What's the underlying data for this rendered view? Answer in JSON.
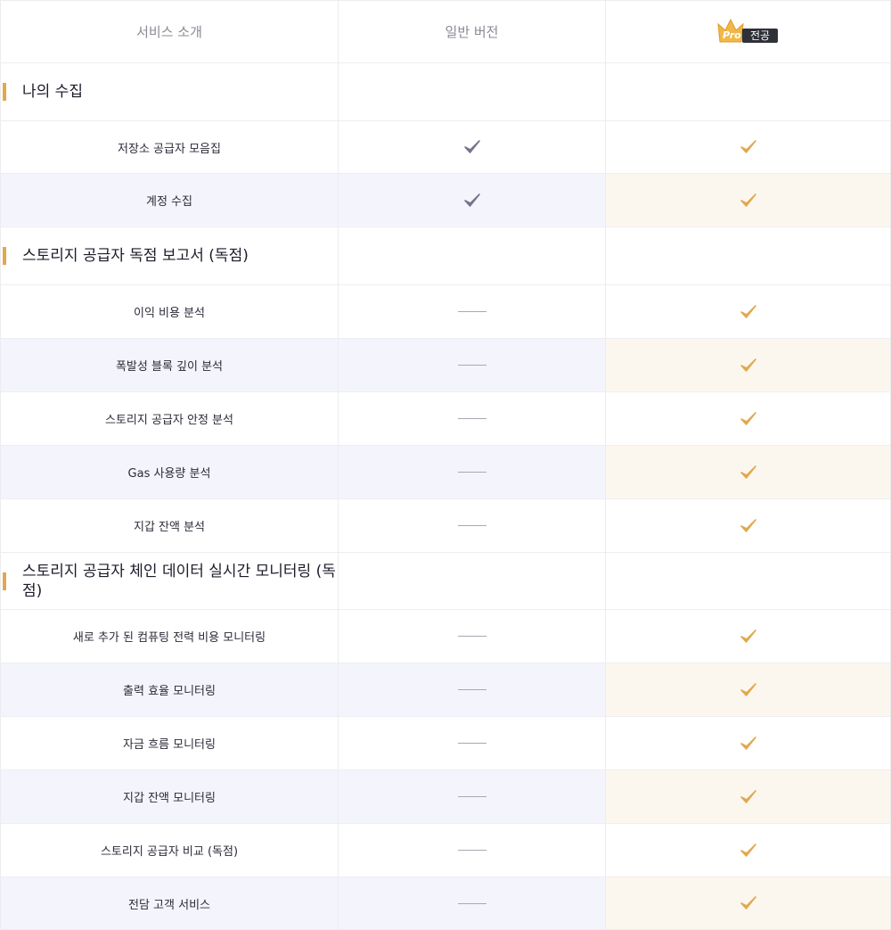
{
  "header": {
    "intro": "서비스 소개",
    "basic": "일반 버전",
    "pro_word": "Pro",
    "pro_exclusive": "전공"
  },
  "colors": {
    "accent": "#e0a94e",
    "basic_check": "#73738a",
    "pro_check": "#e0a94e"
  },
  "rows": [
    {
      "type": "section",
      "title": "나의 수집"
    },
    {
      "type": "feature",
      "label": "저장소 공급자 모음집",
      "basic": "check",
      "pro": "check"
    },
    {
      "type": "feature",
      "label": "계정 수집",
      "basic": "check",
      "pro": "check"
    },
    {
      "type": "section",
      "title": "스토리지 공급자 독점 보고서  (독점)"
    },
    {
      "type": "feature",
      "label": "이익 비용 분석",
      "basic": "none",
      "pro": "check"
    },
    {
      "type": "feature",
      "label": "폭발성 블록 깊이 분석",
      "basic": "none",
      "pro": "check"
    },
    {
      "type": "feature",
      "label": "스토리지 공급자 안정 분석",
      "basic": "none",
      "pro": "check"
    },
    {
      "type": "feature",
      "label": "Gas 사용량 분석",
      "basic": "none",
      "pro": "check"
    },
    {
      "type": "feature",
      "label": "지갑 잔액 분석",
      "basic": "none",
      "pro": "check"
    },
    {
      "type": "section",
      "title": "스토리지 공급자 체인 데이터 실시간 모니터링 (독점)"
    },
    {
      "type": "feature",
      "label": "새로 추가 된 컴퓨팅 전력 비용 모니터링",
      "basic": "none",
      "pro": "check"
    },
    {
      "type": "feature",
      "label": "출력 효율 모니터링",
      "basic": "none",
      "pro": "check"
    },
    {
      "type": "feature",
      "label": "자금 흐름 모니터링",
      "basic": "none",
      "pro": "check"
    },
    {
      "type": "feature",
      "label": "지갑 잔액 모니터링",
      "basic": "none",
      "pro": "check"
    },
    {
      "type": "feature",
      "label": "스토리지 공급자 비교 (독점)",
      "basic": "none",
      "pro": "check"
    },
    {
      "type": "feature",
      "label": "전담 고객 서비스",
      "basic": "none",
      "pro": "check"
    }
  ]
}
